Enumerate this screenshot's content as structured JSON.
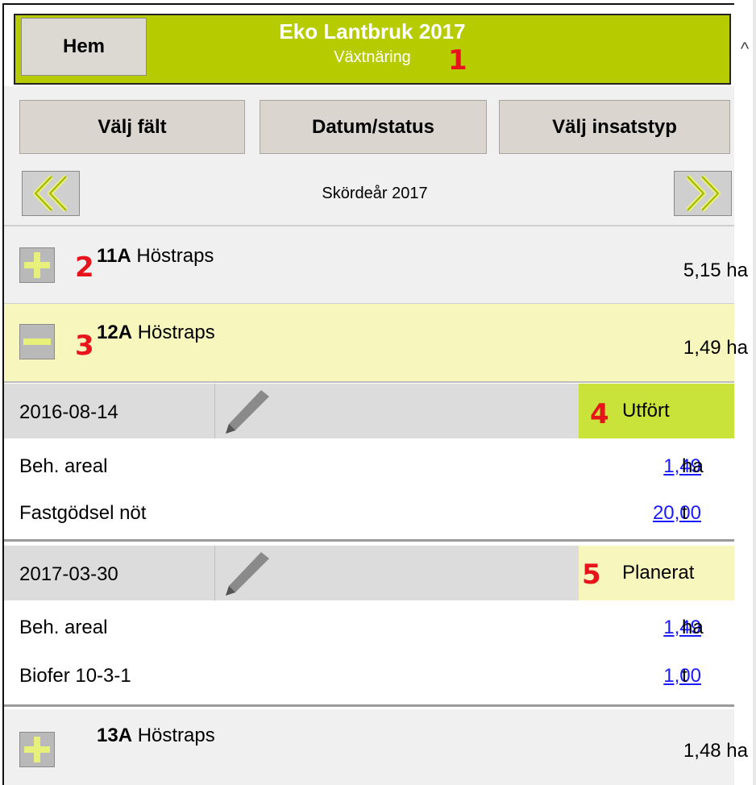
{
  "header": {
    "home_label": "Hem",
    "title": "Eko Lantbruk 2017",
    "subtitle": "Växtnäring",
    "accent_color": "#b7cc00"
  },
  "markers": [
    "1",
    "2",
    "3",
    "4",
    "5"
  ],
  "nav": {
    "select_field": "Välj fält",
    "date_status": "Datum/status",
    "select_input_type": "Välj insatstyp"
  },
  "year": {
    "label": "Skördeår 2017",
    "prev_icon": "double-chevron-left-icon",
    "next_icon": "double-chevron-right-icon"
  },
  "fields": [
    {
      "id": "11A",
      "crop": "Höstraps",
      "area": "5,15 ha",
      "expanded": false
    },
    {
      "id": "12A",
      "crop": "Höstraps",
      "area": "1,49 ha",
      "expanded": true
    },
    {
      "id": "13A",
      "crop": "Höstraps",
      "area": "1,48 ha",
      "expanded": false
    }
  ],
  "events": [
    {
      "date": "2016-08-14",
      "status": "Utfört",
      "status_color": "#c9e33a",
      "details": [
        {
          "label": "Beh. areal",
          "value": "1,49",
          "unit": "ha"
        },
        {
          "label": "Fastgödsel nöt",
          "value": "20,00",
          "unit": "t"
        }
      ]
    },
    {
      "date": "2017-03-30",
      "status": "Planerat",
      "status_color": "#f6f6bd",
      "details": [
        {
          "label": "Beh. areal",
          "value": "1,49",
          "unit": "ha"
        },
        {
          "label": "Biofer 10-3-1",
          "value": "1,00",
          "unit": "t"
        }
      ]
    }
  ]
}
